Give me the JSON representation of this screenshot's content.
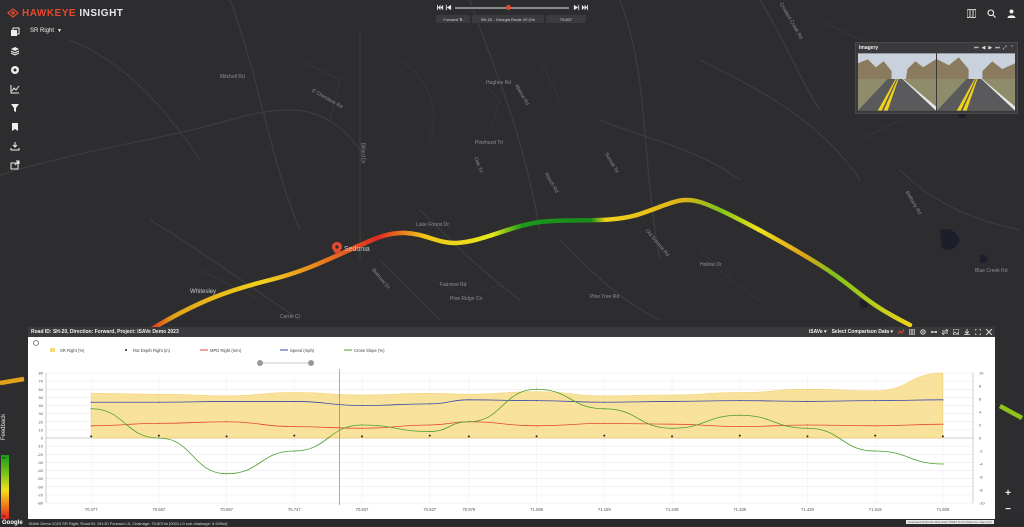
{
  "brand": {
    "name_part1": "HAWKEYE",
    "name_part2": " INSIGHT"
  },
  "toolbar": {
    "items": [
      {
        "name": "layers-copy-icon"
      },
      {
        "name": "stack-icon"
      },
      {
        "name": "target-icon"
      },
      {
        "name": "chart-icon"
      },
      {
        "name": "filter-icon"
      },
      {
        "name": "bookmark-icon"
      },
      {
        "name": "download-icon"
      },
      {
        "name": "share-icon"
      }
    ]
  },
  "route_select": {
    "label": "SR Right"
  },
  "playback": {
    "progress": 0.45,
    "direction_label": "Forward",
    "road_label": "SH-20 - Georgia Route 20 (Ge",
    "chainage_value": "70.807"
  },
  "imagery": {
    "title": "Imagery"
  },
  "map": {
    "town": "Sedonia",
    "town2": "Whitesley",
    "streets": [
      "E Cherokee Rd",
      "Hughes Rd",
      "Pinehurst Trl",
      "Walnut Rd",
      "Dillard Dr",
      "Oak Trl",
      "Ranch Rd",
      "Sunset Trl",
      "Crooked Creek Rd",
      "Old Summit Rd",
      "Fairview Rd",
      "Lake Forest Dr",
      "Pine Ridge Cir",
      "Bethany Rd",
      "Blue Creek Rd",
      "Pine Tree Rd",
      "Mitchell Rd",
      "Hollow Dr",
      "Belmont Dr",
      "Carrie Cl"
    ]
  },
  "chart_panel": {
    "title": "Road ID: SH-20, Direction: Forward, Project: iSAVe Demo 2023",
    "metric_dropdown": "iSAVe",
    "comparison_dropdown": "Select Comparison Data"
  },
  "chart_data": {
    "type": "line",
    "x": [
      70.477,
      70.567,
      70.657,
      70.747,
      70.837,
      70.927,
      70.979,
      71.069,
      71.159,
      71.249,
      71.339,
      71.429,
      71.519,
      71.609
    ],
    "x_tick_labels": [
      "70.477",
      "70.567",
      "70.657",
      "70.747",
      "70.837",
      "70.927",
      "70.979",
      "71.069",
      "71.159",
      "71.249",
      "71.339",
      "71.429",
      "71.519",
      "71.609"
    ],
    "ylim_left": [
      -80,
      80
    ],
    "ylim_right": [
      -10,
      10
    ],
    "y_left_ticks": [
      "80",
      "70",
      "60",
      "50",
      "40",
      "30",
      "20",
      "10",
      "0",
      "-10",
      "-20",
      "-30",
      "-40",
      "-50",
      "-60",
      "-70",
      "-80"
    ],
    "y_right_ticks": [
      "10",
      "8",
      "6",
      "4",
      "2",
      "0",
      "-2",
      "-4",
      "-6",
      "-8",
      "-10"
    ],
    "marker_x": 70.807,
    "legend_position": "top",
    "series": [
      {
        "name": "SR Right (%)",
        "type": "area",
        "color": "#f7d87a",
        "values": [
          55,
          54,
          52,
          56,
          53,
          55,
          54,
          57,
          52,
          53,
          56,
          60,
          58,
          80
        ]
      },
      {
        "name": "Rut Depth Right (in)",
        "type": "dots",
        "color": "#222222",
        "values": [
          2,
          3,
          2,
          3,
          2,
          3,
          2,
          2,
          3,
          2,
          3,
          2,
          3,
          2
        ]
      },
      {
        "name": "MPD Right (mm)",
        "type": "line",
        "color": "#e2492f",
        "values": [
          15,
          18,
          20,
          14,
          12,
          16,
          20,
          15,
          18,
          17,
          14,
          16,
          15,
          17
        ]
      },
      {
        "name": "Speed (mph)",
        "type": "line",
        "color": "#3a4aa8",
        "values": [
          44,
          44,
          45,
          45,
          40,
          42,
          47,
          46,
          44,
          45,
          46,
          45,
          46,
          47
        ]
      },
      {
        "name": "Cross Slope (%)",
        "type": "line",
        "color": "#4aa02a",
        "values": [
          4.5,
          0,
          -5.5,
          -2,
          2,
          1,
          2.5,
          7.5,
          4.5,
          1.5,
          3.5,
          1.5,
          -2,
          -4
        ]
      }
    ]
  },
  "footer": {
    "google": "Google",
    "status": "iSAVe Demo 2023 SR Right, Road ID: SH-20 Forward L0, Chainage: 70.807mi [0001 L0 sub-chainage: 5.929mi]",
    "attribution": "Keyboard shortcuts  Map data ©2023  Terms  Report a map error"
  },
  "feedback": {
    "label": "Feedback"
  },
  "legend_bar": {
    "top": "70",
    "bottom": "30"
  },
  "zoom": {
    "in": "+",
    "out": "−"
  }
}
